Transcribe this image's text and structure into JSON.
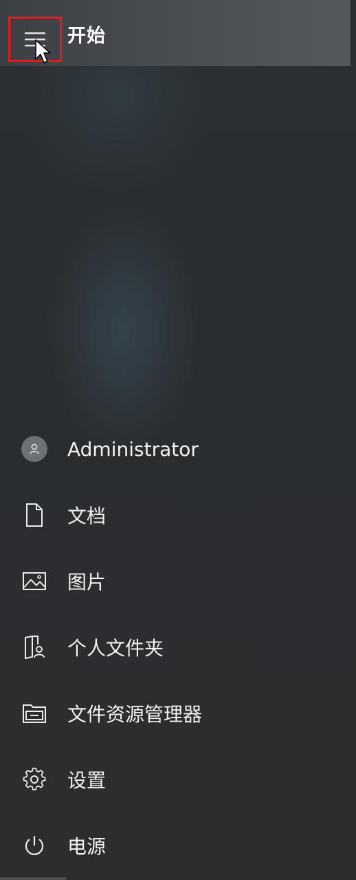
{
  "header": {
    "title": "开始",
    "menu_icon": "hamburger-menu-icon"
  },
  "menu": {
    "items": [
      {
        "label": "Administrator",
        "icon": "user-avatar-icon"
      },
      {
        "label": "文档",
        "icon": "document-icon"
      },
      {
        "label": "图片",
        "icon": "picture-icon"
      },
      {
        "label": "个人文件夹",
        "icon": "personal-folder-icon"
      },
      {
        "label": "文件资源管理器",
        "icon": "file-explorer-icon"
      },
      {
        "label": "设置",
        "icon": "gear-icon"
      },
      {
        "label": "电源",
        "icon": "power-icon"
      }
    ]
  },
  "colors": {
    "highlight_border": "#e01b1b",
    "background": "#2b2f33",
    "text": "#ffffff"
  }
}
